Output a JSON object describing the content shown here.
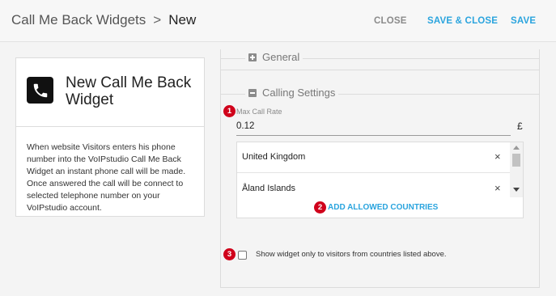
{
  "header": {
    "breadcrumb_parent": "Call Me Back Widgets",
    "breadcrumb_separator": ">",
    "breadcrumb_current": "New",
    "close_label": "CLOSE",
    "save_close_label": "SAVE & CLOSE",
    "save_label": "SAVE"
  },
  "widget_card": {
    "icon": "phone-icon",
    "title": "New Call Me Back Widget",
    "description": "When website Visitors enters his phone number into the VoIPstudio Call Me Back Widget an instant phone call will be made. Once answered the call will be connect to selected telephone number on your VoIPstudio account."
  },
  "sections": {
    "general": {
      "label": "General",
      "state": "collapsed"
    },
    "calling": {
      "label": "Calling Settings",
      "state": "expanded"
    }
  },
  "max_call_rate": {
    "label": "Max Call Rate",
    "value": "0.12",
    "currency": "£"
  },
  "allowed_countries": {
    "items": [
      {
        "name": "United Kingdom",
        "remove": "×"
      },
      {
        "name": "Åland Islands",
        "remove": "×"
      }
    ],
    "add_label": "ADD ALLOWED COUNTRIES"
  },
  "restrict_checkbox": {
    "label": "Show widget only to visitors from countries listed above.",
    "checked": false
  },
  "badges": [
    "1",
    "2",
    "3"
  ],
  "colors": {
    "accent": "#2aa4de",
    "badge": "#d0021b"
  }
}
